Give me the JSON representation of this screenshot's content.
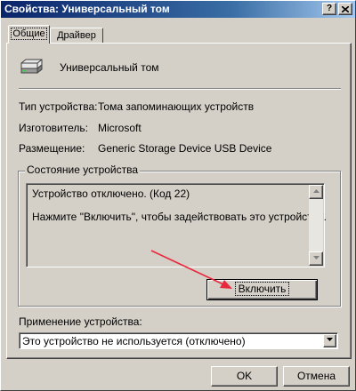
{
  "window": {
    "title": "Свойства: Универсальный том",
    "help_label": "?",
    "close_label": "✕"
  },
  "tabs": [
    {
      "label": "Общие",
      "selected": true
    },
    {
      "label": "Драйвер",
      "selected": false
    }
  ],
  "device": {
    "name": "Универсальный том",
    "icon": "drive-icon",
    "properties": [
      {
        "label": "Тип устройства:",
        "value": "Тома запоминающих устройств"
      },
      {
        "label": "Изготовитель:",
        "value": "Microsoft"
      },
      {
        "label": "Размещение:",
        "value": "Generic Storage Device USB Device"
      }
    ]
  },
  "status": {
    "group_title": "Состояние устройства",
    "lines": [
      "Устройство отключено. (Код 22)",
      "Нажмите \"Включить\", чтобы задействовать это устройство."
    ],
    "enable_label": "Включить"
  },
  "usage": {
    "label": "Применение устройства:",
    "selected": "Это устройство не используется (отключено)"
  },
  "footer": {
    "ok_label": "OK",
    "cancel_label": "Отмена"
  },
  "colors": {
    "title_start": "#0a246a",
    "title_end": "#a6caf0",
    "face": "#d4d0c8",
    "annotation_arrow": "#e8283c"
  }
}
